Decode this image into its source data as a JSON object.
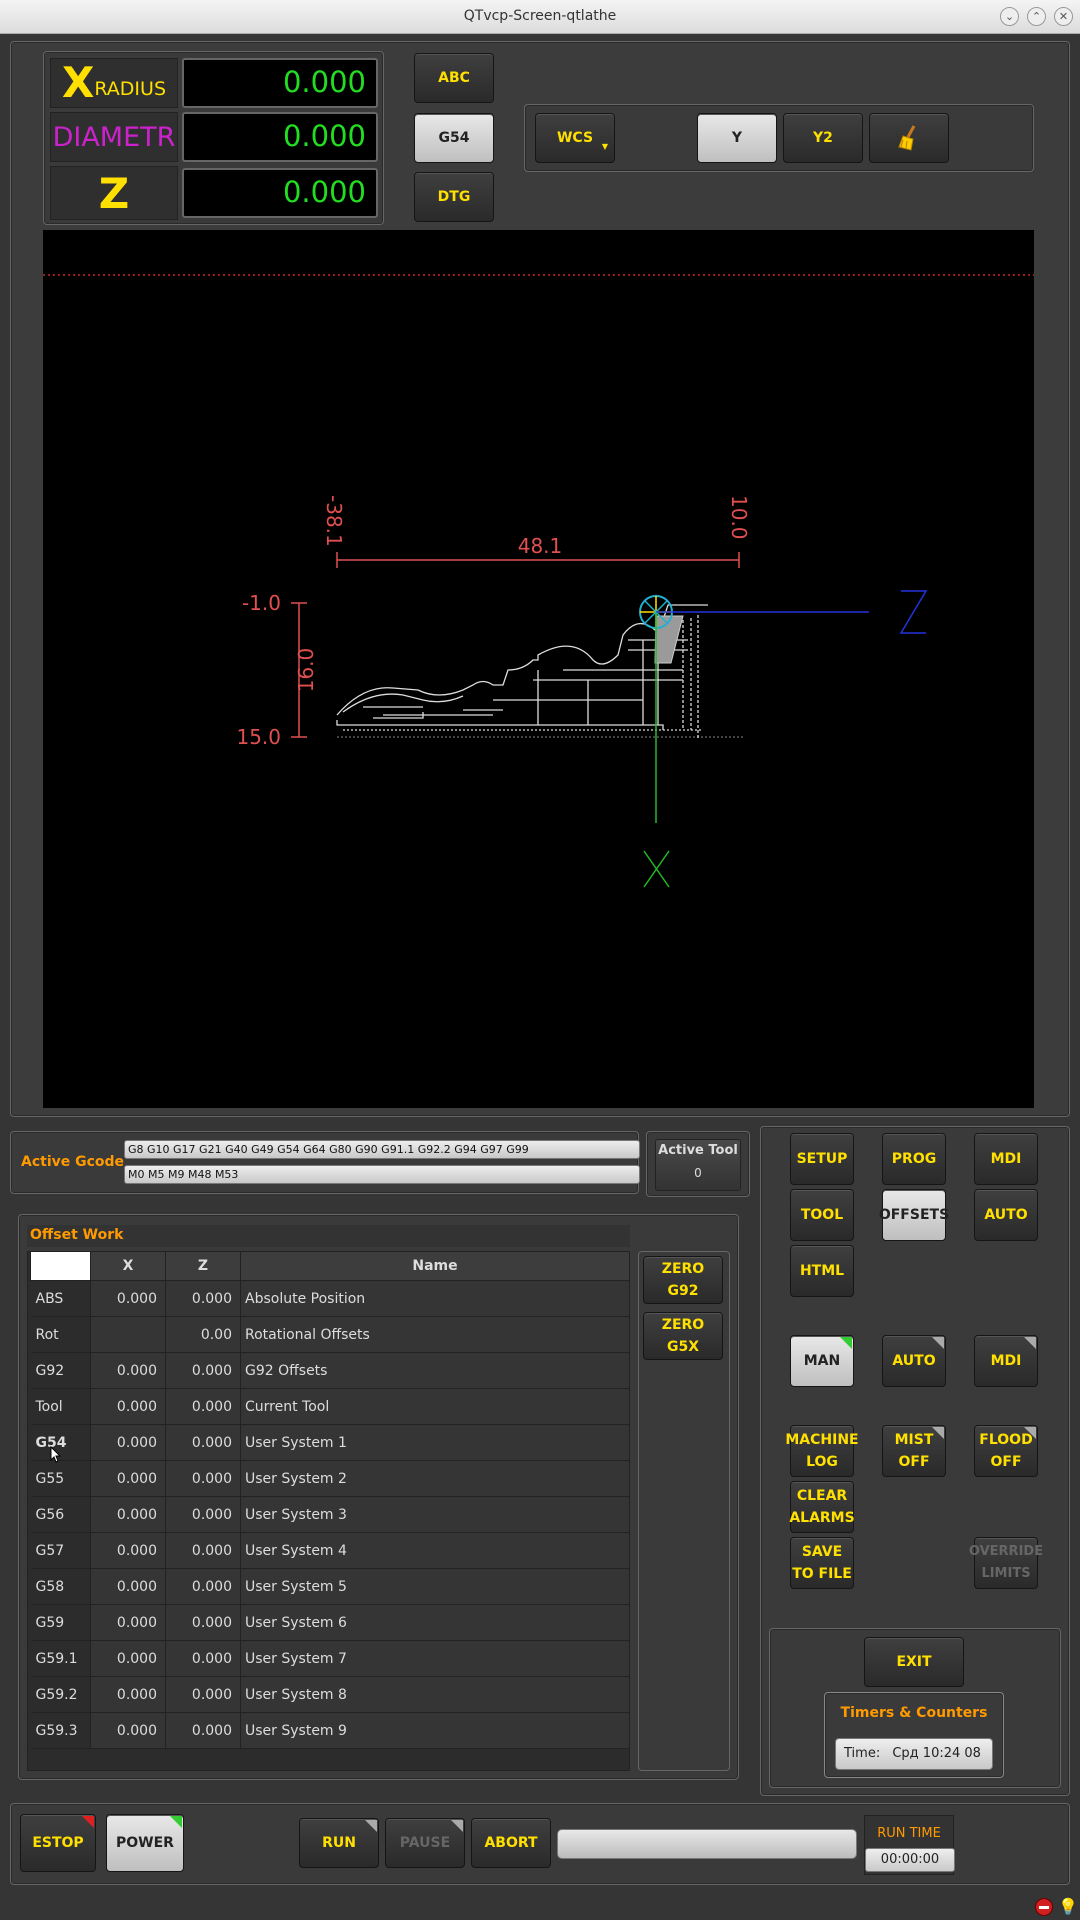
{
  "window": {
    "title": "QTvcp-Screen-qtlathe"
  },
  "dro": {
    "x_letter": "X",
    "x_suffix": "RADIUS",
    "x_value": "0.000",
    "diameter_label": "DIAMETR",
    "diameter_value": "0.000",
    "z_letter": "Z",
    "z_value": "0.000"
  },
  "dro_mode": {
    "abc": "ABC",
    "g54": "G54",
    "dtg": "DTG"
  },
  "view": {
    "wcs": "WCS",
    "y": "Y",
    "y2": "Y2"
  },
  "preview": {
    "dim_z_left": "-38.1",
    "dim_z_right": "10.0",
    "dim_z_length": "48.1",
    "dim_x_top": "-1.0",
    "dim_x_bottom": "15.0",
    "dim_x_length": "16.0",
    "axis_z": "Z",
    "axis_x": "X"
  },
  "active_gcode": {
    "label": "Active Gcode",
    "gcodes": "G8 G10 G17 G21 G40 G49 G54 G64 G80 G90 G91.1 G92.2 G94 G97 G99",
    "mcodes": "M0 M5 M9 M48 M53"
  },
  "active_tool": {
    "label": "Active Tool",
    "value": "0"
  },
  "offsets": {
    "title": "Offset Work",
    "headers": [
      "",
      "X",
      "Z",
      "Name"
    ],
    "rows": [
      {
        "id": "ABS",
        "x": "0.000",
        "z": "0.000",
        "name": "Absolute Position"
      },
      {
        "id": "Rot",
        "x": "",
        "z": "0.00",
        "name": "Rotational Offsets"
      },
      {
        "id": "G92",
        "x": "0.000",
        "z": "0.000",
        "name": "G92 Offsets"
      },
      {
        "id": "Tool",
        "x": "0.000",
        "z": "0.000",
        "name": "Current Tool"
      },
      {
        "id": "G54",
        "x": "0.000",
        "z": "0.000",
        "name": "User System 1"
      },
      {
        "id": "G55",
        "x": "0.000",
        "z": "0.000",
        "name": "User System 2"
      },
      {
        "id": "G56",
        "x": "0.000",
        "z": "0.000",
        "name": "User System 3"
      },
      {
        "id": "G57",
        "x": "0.000",
        "z": "0.000",
        "name": "User System 4"
      },
      {
        "id": "G58",
        "x": "0.000",
        "z": "0.000",
        "name": "User System 5"
      },
      {
        "id": "G59",
        "x": "0.000",
        "z": "0.000",
        "name": "User System 6"
      },
      {
        "id": "G59.1",
        "x": "0.000",
        "z": "0.000",
        "name": "User System 7"
      },
      {
        "id": "G59.2",
        "x": "0.000",
        "z": "0.000",
        "name": "User System 8"
      },
      {
        "id": "G59.3",
        "x": "0.000",
        "z": "0.000",
        "name": "User System 9"
      }
    ],
    "zero_g92": "ZERO G92",
    "zero_g5x": "ZERO G5X"
  },
  "tabs": {
    "setup": "SETUP",
    "prog": "PROG",
    "mdi": "MDI",
    "tool": "TOOL",
    "offsets": "OFFSETS",
    "auto": "AUTO",
    "html": "HTML"
  },
  "modes": {
    "man": "MAN",
    "auto": "AUTO",
    "mdi": "MDI"
  },
  "actions": {
    "machine_log_1": "MACHINE",
    "machine_log_2": "LOG",
    "mist_1": "MIST",
    "mist_2": "OFF",
    "flood_1": "FLOOD",
    "flood_2": "OFF",
    "clear_1": "CLEAR",
    "clear_2": "ALARMS",
    "save_1": "SAVE",
    "save_2": "TO FILE",
    "override_1": "OVERRIDE",
    "override_2": "LIMITS"
  },
  "exit": "EXIT",
  "timers": {
    "title": "Timers & Counters",
    "time_label": "Time:",
    "time_value": "Срд 10:24 08"
  },
  "bottom": {
    "estop": "ESTOP",
    "power": "POWER",
    "run": "RUN",
    "pause": "PAUSE",
    "abort": "ABORT",
    "run_time_label": "RUN TIME",
    "run_time_value": "00:00:00"
  }
}
